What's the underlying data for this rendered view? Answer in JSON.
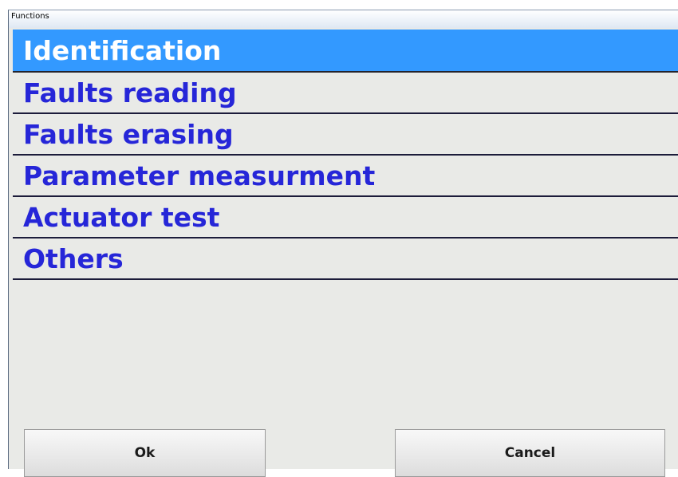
{
  "window": {
    "title": "Functions"
  },
  "functions": {
    "items": [
      {
        "label": "Identification",
        "selected": true
      },
      {
        "label": "Faults reading",
        "selected": false
      },
      {
        "label": "Faults erasing",
        "selected": false
      },
      {
        "label": "Parameter measurment",
        "selected": false
      },
      {
        "label": "Actuator test",
        "selected": false
      },
      {
        "label": "Others",
        "selected": false
      }
    ]
  },
  "buttons": {
    "ok_label": "Ok",
    "cancel_label": "Cancel"
  },
  "colors": {
    "selected_bg": "#3399ff",
    "item_text": "#2626d8",
    "panel_bg": "#e9eae7"
  }
}
